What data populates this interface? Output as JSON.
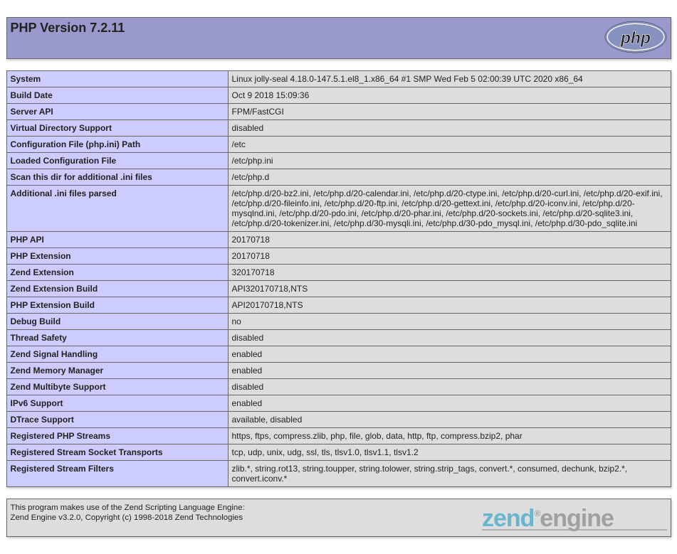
{
  "header": {
    "title": "PHP Version 7.2.11",
    "logo_alt": "PHP logo"
  },
  "rows": [
    {
      "label": "System",
      "value": "Linux jolly-seal 4.18.0-147.5.1.el8_1.x86_64 #1 SMP Wed Feb 5 02:00:39 UTC 2020 x86_64"
    },
    {
      "label": "Build Date",
      "value": "Oct 9 2018 15:09:36"
    },
    {
      "label": "Server API",
      "value": "FPM/FastCGI"
    },
    {
      "label": "Virtual Directory Support",
      "value": "disabled"
    },
    {
      "label": "Configuration File (php.ini) Path",
      "value": "/etc"
    },
    {
      "label": "Loaded Configuration File",
      "value": "/etc/php.ini"
    },
    {
      "label": "Scan this dir for additional .ini files",
      "value": "/etc/php.d"
    },
    {
      "label": "Additional .ini files parsed",
      "value": "/etc/php.d/20-bz2.ini, /etc/php.d/20-calendar.ini, /etc/php.d/20-ctype.ini, /etc/php.d/20-curl.ini, /etc/php.d/20-exif.ini, /etc/php.d/20-fileinfo.ini, /etc/php.d/20-ftp.ini, /etc/php.d/20-gettext.ini, /etc/php.d/20-iconv.ini, /etc/php.d/20-mysqlnd.ini, /etc/php.d/20-pdo.ini, /etc/php.d/20-phar.ini, /etc/php.d/20-sockets.ini, /etc/php.d/20-sqlite3.ini, /etc/php.d/20-tokenizer.ini, /etc/php.d/30-mysqli.ini, /etc/php.d/30-pdo_mysql.ini, /etc/php.d/30-pdo_sqlite.ini"
    },
    {
      "label": "PHP API",
      "value": "20170718"
    },
    {
      "label": "PHP Extension",
      "value": "20170718"
    },
    {
      "label": "Zend Extension",
      "value": "320170718"
    },
    {
      "label": "Zend Extension Build",
      "value": "API320170718,NTS"
    },
    {
      "label": "PHP Extension Build",
      "value": "API20170718,NTS"
    },
    {
      "label": "Debug Build",
      "value": "no"
    },
    {
      "label": "Thread Safety",
      "value": "disabled"
    },
    {
      "label": "Zend Signal Handling",
      "value": "enabled"
    },
    {
      "label": "Zend Memory Manager",
      "value": "enabled"
    },
    {
      "label": "Zend Multibyte Support",
      "value": "disabled"
    },
    {
      "label": "IPv6 Support",
      "value": "enabled"
    },
    {
      "label": "DTrace Support",
      "value": "available, disabled"
    },
    {
      "label": "Registered PHP Streams",
      "value": "https, ftps, compress.zlib, php, file, glob, data, http, ftp, compress.bzip2, phar"
    },
    {
      "label": "Registered Stream Socket Transports",
      "value": "tcp, udp, unix, udg, ssl, tls, tlsv1.0, tlsv1.1, tlsv1.2"
    },
    {
      "label": "Registered Stream Filters",
      "value": "zlib.*, string.rot13, string.toupper, string.tolower, string.strip_tags, convert.*, consumed, dechunk, bzip2.*, convert.iconv.*"
    }
  ],
  "footer": {
    "line1": "This program makes use of the Zend Scripting Language Engine:",
    "line2": "Zend Engine v3.2.0, Copyright (c) 1998-2018 Zend Technologies",
    "logo_alt": "Zend engine logo"
  }
}
